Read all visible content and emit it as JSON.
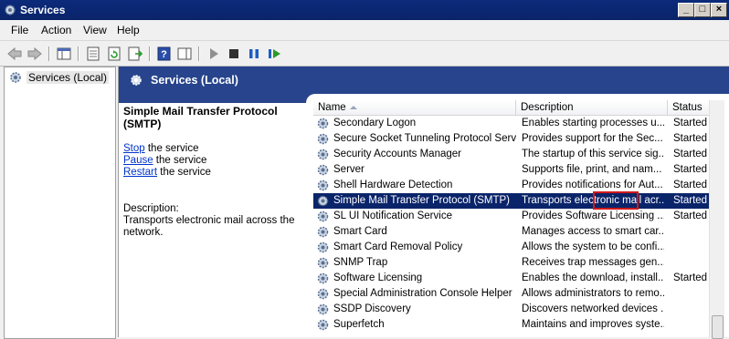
{
  "window": {
    "title": "Services"
  },
  "menu": [
    "File",
    "Action",
    "View",
    "Help"
  ],
  "tree": {
    "root_label": "Services (Local)"
  },
  "pane": {
    "title": "Services (Local)"
  },
  "description": {
    "service_title": "Simple Mail Transfer Protocol (SMTP)",
    "actions": [
      {
        "link": "Stop",
        "rest": " the service"
      },
      {
        "link": "Pause",
        "rest": " the service"
      },
      {
        "link": "Restart",
        "rest": " the service"
      }
    ],
    "label": "Description:",
    "text": "Transports electronic mail across the network."
  },
  "columns": {
    "name": "Name",
    "description": "Description",
    "status": "Status"
  },
  "services": [
    {
      "name": "Secondary Logon",
      "description": "Enables starting processes u...",
      "status": "Started"
    },
    {
      "name": "Secure Socket Tunneling Protocol Service",
      "description": "Provides support for the Sec...",
      "status": "Started"
    },
    {
      "name": "Security Accounts Manager",
      "description": "The startup of this service sig...",
      "status": "Started"
    },
    {
      "name": "Server",
      "description": "Supports file, print, and nam...",
      "status": "Started"
    },
    {
      "name": "Shell Hardware Detection",
      "description": "Provides notifications for Aut...",
      "status": "Started"
    },
    {
      "name": "Simple Mail Transfer Protocol (SMTP)",
      "description": "Transports electronic mail acr...",
      "status": "Started",
      "selected": true
    },
    {
      "name": "SL UI Notification Service",
      "description": "Provides Software Licensing ...",
      "status": "Started"
    },
    {
      "name": "Smart Card",
      "description": "Manages access to smart car...",
      "status": ""
    },
    {
      "name": "Smart Card Removal Policy",
      "description": "Allows the system to be confi...",
      "status": ""
    },
    {
      "name": "SNMP Trap",
      "description": "Receives trap messages gen...",
      "status": ""
    },
    {
      "name": "Software Licensing",
      "description": "Enables the download, install...",
      "status": "Started"
    },
    {
      "name": "Special Administration Console Helper",
      "description": "Allows administrators to remo...",
      "status": ""
    },
    {
      "name": "SSDP Discovery",
      "description": "Discovers networked devices ...",
      "status": ""
    },
    {
      "name": "Superfetch",
      "description": "Maintains and improves syste...",
      "status": ""
    }
  ],
  "colors": {
    "selection": "#0a246a",
    "header": "#27448c",
    "highlight": "#d01a1a"
  }
}
